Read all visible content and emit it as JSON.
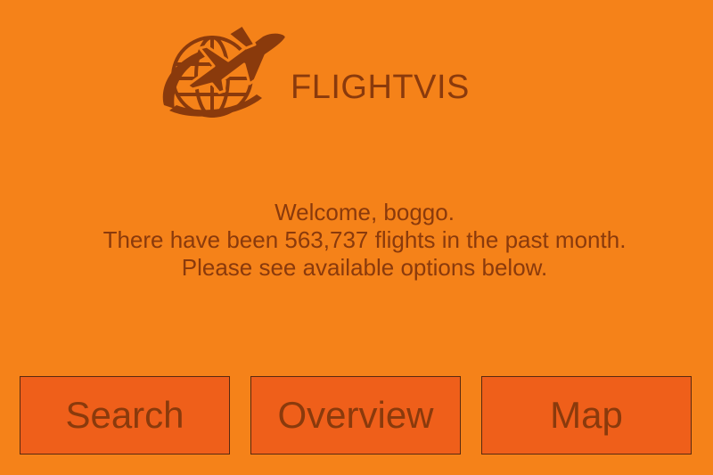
{
  "app": {
    "title": "FLIGHTVIS",
    "logo_icon": "globe-airplane-icon"
  },
  "welcome": {
    "line1": "Welcome, boggo.",
    "line2": "There have been 563,737 flights in the past month.",
    "line3": "Please see available options below."
  },
  "buttons": {
    "search": "Search",
    "overview": "Overview",
    "map": "Map"
  },
  "colors": {
    "background": "#f58219",
    "button": "#ef5f1a",
    "text": "#8a3a0c"
  }
}
